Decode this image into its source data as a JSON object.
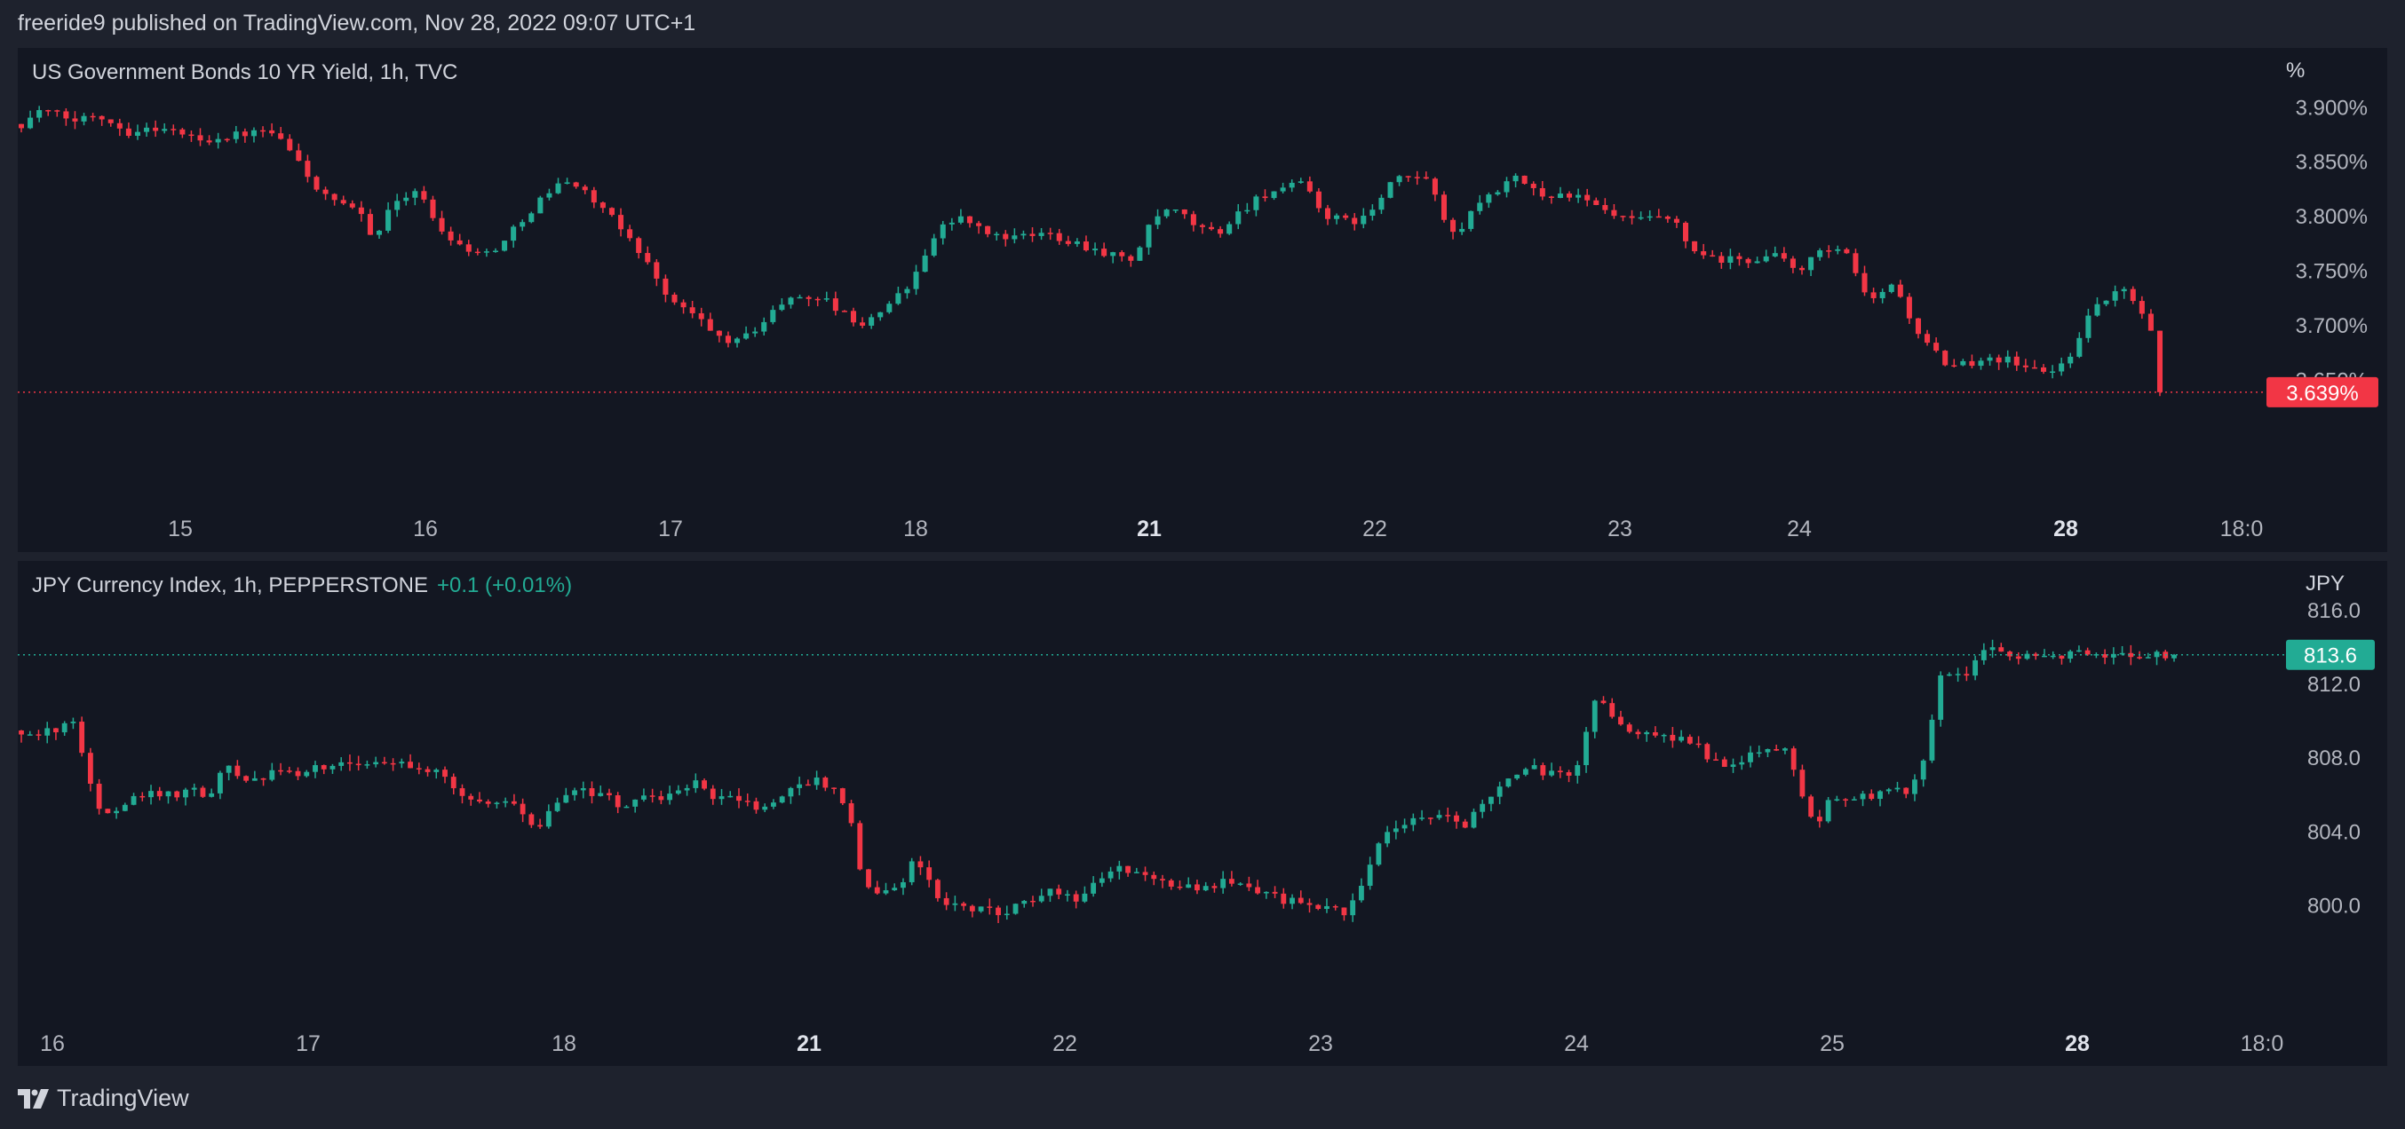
{
  "header": {
    "published_text": "freeride9 published on TradingView.com, Nov 28, 2022 09:07 UTC+1"
  },
  "footer": {
    "brand": "TradingView"
  },
  "colors": {
    "up": "#22ab94",
    "down": "#f23645",
    "background": "#131722",
    "page": "#1e222d",
    "text": "#d1d4dc",
    "axis_text": "#b2b5be"
  },
  "chart_data": [
    {
      "type": "candlestick",
      "title": "US Government Bonds 10 YR Yield, 1h, TVC",
      "unit_label": "%",
      "ylim": [
        3.59,
        3.91
      ],
      "y_ticks": [
        3.65,
        3.7,
        3.75,
        3.8,
        3.85,
        3.9
      ],
      "y_tick_labels": [
        "3.650%",
        "3.700%",
        "3.750%",
        "3.800%",
        "3.850%",
        "3.900%"
      ],
      "x_ticks": [
        {
          "label": "15",
          "bold": false
        },
        {
          "label": "16",
          "bold": false
        },
        {
          "label": "17",
          "bold": false
        },
        {
          "label": "18",
          "bold": false
        },
        {
          "label": "21",
          "bold": true
        },
        {
          "label": "22",
          "bold": false
        },
        {
          "label": "23",
          "bold": false
        },
        {
          "label": "24",
          "bold": false
        },
        {
          "label": "28",
          "bold": true
        },
        {
          "label": "18:0",
          "bold": false
        }
      ],
      "last_price": 3.639,
      "last_price_label": "3.639%",
      "last_price_color": "#f23645",
      "grid": false,
      "keypoints": [
        {
          "x": 0.002,
          "y": 3.885
        },
        {
          "x": 0.008,
          "y": 3.898
        },
        {
          "x": 0.025,
          "y": 3.888
        },
        {
          "x": 0.035,
          "y": 3.895
        },
        {
          "x": 0.05,
          "y": 3.878
        },
        {
          "x": 0.065,
          "y": 3.882
        },
        {
          "x": 0.085,
          "y": 3.87
        },
        {
          "x": 0.1,
          "y": 3.875
        },
        {
          "x": 0.115,
          "y": 3.878
        },
        {
          "x": 0.12,
          "y": 3.872
        },
        {
          "x": 0.13,
          "y": 3.85
        },
        {
          "x": 0.14,
          "y": 3.82
        },
        {
          "x": 0.15,
          "y": 3.81
        },
        {
          "x": 0.16,
          "y": 3.8
        },
        {
          "x": 0.165,
          "y": 3.78
        },
        {
          "x": 0.175,
          "y": 3.815
        },
        {
          "x": 0.185,
          "y": 3.825
        },
        {
          "x": 0.195,
          "y": 3.79
        },
        {
          "x": 0.205,
          "y": 3.775
        },
        {
          "x": 0.215,
          "y": 3.765
        },
        {
          "x": 0.225,
          "y": 3.775
        },
        {
          "x": 0.235,
          "y": 3.8
        },
        {
          "x": 0.245,
          "y": 3.82
        },
        {
          "x": 0.255,
          "y": 3.835
        },
        {
          "x": 0.265,
          "y": 3.82
        },
        {
          "x": 0.275,
          "y": 3.8
        },
        {
          "x": 0.285,
          "y": 3.78
        },
        {
          "x": 0.295,
          "y": 3.75
        },
        {
          "x": 0.305,
          "y": 3.72
        },
        {
          "x": 0.315,
          "y": 3.71
        },
        {
          "x": 0.325,
          "y": 3.69
        },
        {
          "x": 0.335,
          "y": 3.685
        },
        {
          "x": 0.345,
          "y": 3.7
        },
        {
          "x": 0.355,
          "y": 3.72
        },
        {
          "x": 0.365,
          "y": 3.728
        },
        {
          "x": 0.375,
          "y": 3.725
        },
        {
          "x": 0.385,
          "y": 3.71
        },
        {
          "x": 0.395,
          "y": 3.7
        },
        {
          "x": 0.405,
          "y": 3.72
        },
        {
          "x": 0.415,
          "y": 3.735
        },
        {
          "x": 0.42,
          "y": 3.76
        },
        {
          "x": 0.43,
          "y": 3.79
        },
        {
          "x": 0.44,
          "y": 3.8
        },
        {
          "x": 0.45,
          "y": 3.785
        },
        {
          "x": 0.465,
          "y": 3.78
        },
        {
          "x": 0.48,
          "y": 3.785
        },
        {
          "x": 0.495,
          "y": 3.775
        },
        {
          "x": 0.51,
          "y": 3.765
        },
        {
          "x": 0.52,
          "y": 3.76
        },
        {
          "x": 0.53,
          "y": 3.8
        },
        {
          "x": 0.54,
          "y": 3.805
        },
        {
          "x": 0.55,
          "y": 3.79
        },
        {
          "x": 0.56,
          "y": 3.785
        },
        {
          "x": 0.57,
          "y": 3.805
        },
        {
          "x": 0.58,
          "y": 3.82
        },
        {
          "x": 0.59,
          "y": 3.825
        },
        {
          "x": 0.6,
          "y": 3.83
        },
        {
          "x": 0.61,
          "y": 3.8
        },
        {
          "x": 0.62,
          "y": 3.795
        },
        {
          "x": 0.63,
          "y": 3.8
        },
        {
          "x": 0.64,
          "y": 3.83
        },
        {
          "x": 0.65,
          "y": 3.838
        },
        {
          "x": 0.66,
          "y": 3.83
        },
        {
          "x": 0.665,
          "y": 3.8
        },
        {
          "x": 0.67,
          "y": 3.78
        },
        {
          "x": 0.68,
          "y": 3.81
        },
        {
          "x": 0.69,
          "y": 3.825
        },
        {
          "x": 0.7,
          "y": 3.835
        },
        {
          "x": 0.71,
          "y": 3.82
        },
        {
          "x": 0.725,
          "y": 3.82
        },
        {
          "x": 0.735,
          "y": 3.81
        },
        {
          "x": 0.745,
          "y": 3.8
        },
        {
          "x": 0.755,
          "y": 3.795
        },
        {
          "x": 0.765,
          "y": 3.8
        },
        {
          "x": 0.775,
          "y": 3.79
        },
        {
          "x": 0.78,
          "y": 3.77
        },
        {
          "x": 0.79,
          "y": 3.76
        },
        {
          "x": 0.8,
          "y": 3.76
        },
        {
          "x": 0.81,
          "y": 3.76
        },
        {
          "x": 0.82,
          "y": 3.765
        },
        {
          "x": 0.83,
          "y": 3.75
        },
        {
          "x": 0.84,
          "y": 3.765
        },
        {
          "x": 0.85,
          "y": 3.77
        },
        {
          "x": 0.855,
          "y": 3.76
        },
        {
          "x": 0.86,
          "y": 3.735
        },
        {
          "x": 0.865,
          "y": 3.72
        },
        {
          "x": 0.87,
          "y": 3.73
        },
        {
          "x": 0.875,
          "y": 3.74
        },
        {
          "x": 0.88,
          "y": 3.72
        },
        {
          "x": 0.885,
          "y": 3.7
        },
        {
          "x": 0.89,
          "y": 3.685
        },
        {
          "x": 0.895,
          "y": 3.675
        },
        {
          "x": 0.9,
          "y": 3.66
        },
        {
          "x": 0.91,
          "y": 3.665
        },
        {
          "x": 0.92,
          "y": 3.672
        },
        {
          "x": 0.93,
          "y": 3.668
        },
        {
          "x": 0.94,
          "y": 3.66
        },
        {
          "x": 0.95,
          "y": 3.658
        },
        {
          "x": 0.955,
          "y": 3.665
        },
        {
          "x": 0.96,
          "y": 3.68
        },
        {
          "x": 0.965,
          "y": 3.705
        },
        {
          "x": 0.97,
          "y": 3.715
        },
        {
          "x": 0.975,
          "y": 3.725
        },
        {
          "x": 0.98,
          "y": 3.732
        },
        {
          "x": 0.985,
          "y": 3.73
        },
        {
          "x": 0.99,
          "y": 3.72
        },
        {
          "x": 0.995,
          "y": 3.7
        },
        {
          "x": 1.0,
          "y": 3.69
        },
        {
          "x": 1.005,
          "y": 3.68
        },
        {
          "x": 1.01,
          "y": 3.66
        },
        {
          "x": 1.015,
          "y": 3.652
        },
        {
          "x": 1.025,
          "y": 3.645
        },
        {
          "x": 1.035,
          "y": 3.64
        },
        {
          "x": 1.05,
          "y": 3.639
        }
      ]
    },
    {
      "type": "candlestick",
      "title": "JPY Currency Index, 1h, PEPPERSTONE",
      "change_text": "+0.1 (+0.01%)",
      "unit_label": "JPY",
      "ylim": [
        797,
        817
      ],
      "y_ticks": [
        800,
        804,
        808,
        812,
        816
      ],
      "y_tick_labels": [
        "800.0",
        "804.0",
        "808.0",
        "812.0",
        "816.0"
      ],
      "x_ticks": [
        {
          "label": "16",
          "bold": false
        },
        {
          "label": "17",
          "bold": false
        },
        {
          "label": "18",
          "bold": false
        },
        {
          "label": "21",
          "bold": true
        },
        {
          "label": "22",
          "bold": false
        },
        {
          "label": "23",
          "bold": false
        },
        {
          "label": "24",
          "bold": false
        },
        {
          "label": "25",
          "bold": false
        },
        {
          "label": "28",
          "bold": true
        },
        {
          "label": "18:0",
          "bold": false
        }
      ],
      "last_price": 813.6,
      "last_price_label": "813.6",
      "last_price_color": "#22ab94",
      "grid": false,
      "keypoints": [
        {
          "x": 0.0,
          "y": 809.5
        },
        {
          "x": 0.01,
          "y": 809.3
        },
        {
          "x": 0.02,
          "y": 809.8
        },
        {
          "x": 0.025,
          "y": 810.2
        },
        {
          "x": 0.03,
          "y": 807.5
        },
        {
          "x": 0.035,
          "y": 805.5
        },
        {
          "x": 0.04,
          "y": 805.0
        },
        {
          "x": 0.05,
          "y": 805.8
        },
        {
          "x": 0.06,
          "y": 806.3
        },
        {
          "x": 0.07,
          "y": 806.0
        },
        {
          "x": 0.08,
          "y": 806.2
        },
        {
          "x": 0.085,
          "y": 805.8
        },
        {
          "x": 0.09,
          "y": 806.5
        },
        {
          "x": 0.095,
          "y": 807.5
        },
        {
          "x": 0.1,
          "y": 807.0
        },
        {
          "x": 0.11,
          "y": 806.8
        },
        {
          "x": 0.12,
          "y": 807.3
        },
        {
          "x": 0.13,
          "y": 807.2
        },
        {
          "x": 0.14,
          "y": 807.6
        },
        {
          "x": 0.15,
          "y": 807.8
        },
        {
          "x": 0.16,
          "y": 807.5
        },
        {
          "x": 0.17,
          "y": 807.7
        },
        {
          "x": 0.18,
          "y": 807.6
        },
        {
          "x": 0.19,
          "y": 807.4
        },
        {
          "x": 0.2,
          "y": 806.5
        },
        {
          "x": 0.21,
          "y": 805.8
        },
        {
          "x": 0.22,
          "y": 805.6
        },
        {
          "x": 0.23,
          "y": 805.3
        },
        {
          "x": 0.24,
          "y": 804.0
        },
        {
          "x": 0.25,
          "y": 805.8
        },
        {
          "x": 0.26,
          "y": 806.2
        },
        {
          "x": 0.27,
          "y": 806.0
        },
        {
          "x": 0.28,
          "y": 805.2
        },
        {
          "x": 0.29,
          "y": 806.0
        },
        {
          "x": 0.3,
          "y": 805.8
        },
        {
          "x": 0.31,
          "y": 806.2
        },
        {
          "x": 0.315,
          "y": 807.0
        },
        {
          "x": 0.32,
          "y": 806.0
        },
        {
          "x": 0.33,
          "y": 805.8
        },
        {
          "x": 0.34,
          "y": 805.5
        },
        {
          "x": 0.345,
          "y": 805.2
        },
        {
          "x": 0.35,
          "y": 805.5
        },
        {
          "x": 0.36,
          "y": 806.5
        },
        {
          "x": 0.37,
          "y": 806.8
        },
        {
          "x": 0.375,
          "y": 806.5
        },
        {
          "x": 0.38,
          "y": 806.0
        },
        {
          "x": 0.385,
          "y": 805.0
        },
        {
          "x": 0.39,
          "y": 801.5
        },
        {
          "x": 0.4,
          "y": 800.5
        },
        {
          "x": 0.41,
          "y": 801.5
        },
        {
          "x": 0.415,
          "y": 802.5
        },
        {
          "x": 0.42,
          "y": 801.5
        },
        {
          "x": 0.43,
          "y": 800.0
        },
        {
          "x": 0.44,
          "y": 799.8
        },
        {
          "x": 0.45,
          "y": 799.7
        },
        {
          "x": 0.46,
          "y": 799.8
        },
        {
          "x": 0.47,
          "y": 800.5
        },
        {
          "x": 0.48,
          "y": 800.8
        },
        {
          "x": 0.49,
          "y": 800.3
        },
        {
          "x": 0.5,
          "y": 801.5
        },
        {
          "x": 0.51,
          "y": 802.0
        },
        {
          "x": 0.52,
          "y": 801.5
        },
        {
          "x": 0.53,
          "y": 801.3
        },
        {
          "x": 0.54,
          "y": 801.2
        },
        {
          "x": 0.55,
          "y": 801.0
        },
        {
          "x": 0.56,
          "y": 801.3
        },
        {
          "x": 0.57,
          "y": 800.8
        },
        {
          "x": 0.58,
          "y": 800.5
        },
        {
          "x": 0.59,
          "y": 800.2
        },
        {
          "x": 0.6,
          "y": 800.0
        },
        {
          "x": 0.61,
          "y": 799.8
        },
        {
          "x": 0.615,
          "y": 799.5
        },
        {
          "x": 0.62,
          "y": 800.5
        },
        {
          "x": 0.63,
          "y": 803.5
        },
        {
          "x": 0.64,
          "y": 804.5
        },
        {
          "x": 0.65,
          "y": 804.8
        },
        {
          "x": 0.66,
          "y": 805.2
        },
        {
          "x": 0.67,
          "y": 804.3
        },
        {
          "x": 0.68,
          "y": 805.5
        },
        {
          "x": 0.69,
          "y": 807.0
        },
        {
          "x": 0.7,
          "y": 807.5
        },
        {
          "x": 0.71,
          "y": 807.2
        },
        {
          "x": 0.72,
          "y": 807.0
        },
        {
          "x": 0.725,
          "y": 808.5
        },
        {
          "x": 0.73,
          "y": 811.0
        },
        {
          "x": 0.735,
          "y": 810.8
        },
        {
          "x": 0.74,
          "y": 810.0
        },
        {
          "x": 0.75,
          "y": 809.5
        },
        {
          "x": 0.76,
          "y": 809.3
        },
        {
          "x": 0.77,
          "y": 809.0
        },
        {
          "x": 0.78,
          "y": 808.5
        },
        {
          "x": 0.79,
          "y": 807.5
        },
        {
          "x": 0.8,
          "y": 808.0
        },
        {
          "x": 0.81,
          "y": 808.5
        },
        {
          "x": 0.82,
          "y": 808.3
        },
        {
          "x": 0.825,
          "y": 807.0
        },
        {
          "x": 0.83,
          "y": 805.0
        },
        {
          "x": 0.835,
          "y": 804.5
        },
        {
          "x": 0.84,
          "y": 806.0
        },
        {
          "x": 0.85,
          "y": 805.8
        },
        {
          "x": 0.86,
          "y": 806.0
        },
        {
          "x": 0.87,
          "y": 806.5
        },
        {
          "x": 0.875,
          "y": 806.0
        },
        {
          "x": 0.88,
          "y": 806.8
        },
        {
          "x": 0.885,
          "y": 808.5
        },
        {
          "x": 0.89,
          "y": 812.0
        },
        {
          "x": 0.895,
          "y": 812.8
        },
        {
          "x": 0.9,
          "y": 812.3
        },
        {
          "x": 0.905,
          "y": 812.6
        },
        {
          "x": 0.91,
          "y": 813.5
        },
        {
          "x": 0.915,
          "y": 814.0
        },
        {
          "x": 0.92,
          "y": 813.6
        },
        {
          "x": 0.925,
          "y": 813.5
        },
        {
          "x": 0.93,
          "y": 813.6
        }
      ]
    }
  ]
}
